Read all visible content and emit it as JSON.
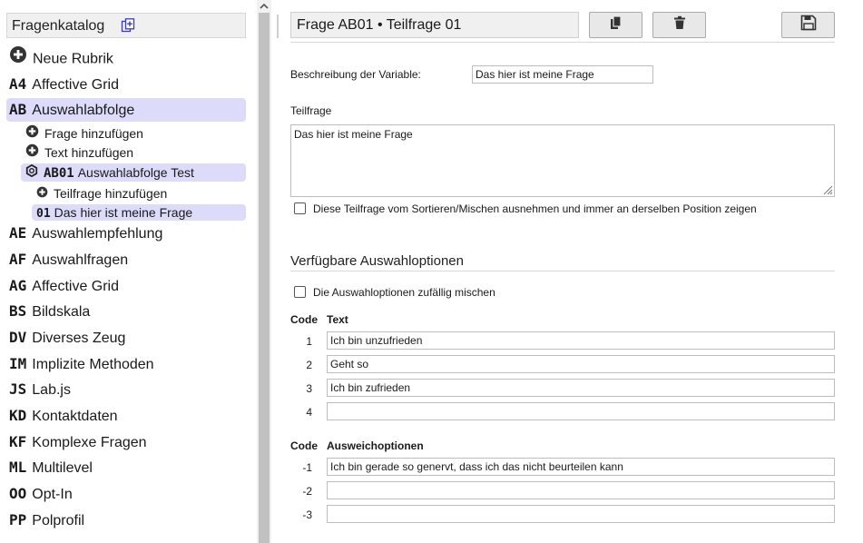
{
  "sidebar": {
    "header": "Fragenkatalog",
    "icons": {
      "header": "copy-add-icon",
      "add": "plus-circle-icon",
      "item": "gear-ring-icon"
    },
    "new_rubric": "Neue Rubrik",
    "rubrics_top": [
      {
        "code": "A4",
        "label": "Affective Grid"
      },
      {
        "code": "AB",
        "label": "Auswahlabfolge"
      }
    ],
    "ab_children": {
      "add_question": "Frage hinzufügen",
      "add_text": "Text hinzufügen",
      "question": {
        "code": "AB01",
        "label": "Auswahlabfolge Test"
      },
      "add_subquestion": "Teilfrage hinzufügen",
      "subquestion": {
        "code": "01",
        "label": "Das hier ist meine Frage"
      }
    },
    "rubrics_rest": [
      {
        "code": "AE",
        "label": "Auswahlempfehlung"
      },
      {
        "code": "AF",
        "label": "Auswahlfragen"
      },
      {
        "code": "AG",
        "label": "Affective Grid"
      },
      {
        "code": "BS",
        "label": "Bildskala"
      },
      {
        "code": "DV",
        "label": "Diverses Zeug"
      },
      {
        "code": "IM",
        "label": "Implizite Methoden"
      },
      {
        "code": "JS",
        "label": "Lab.js"
      },
      {
        "code": "KD",
        "label": "Kontaktdaten"
      },
      {
        "code": "KF",
        "label": "Komplexe Fragen"
      },
      {
        "code": "ML",
        "label": "Multilevel"
      },
      {
        "code": "OO",
        "label": "Opt-In"
      },
      {
        "code": "PP",
        "label": "Polprofil"
      }
    ]
  },
  "main": {
    "title": "Frage AB01  •  Teilfrage 01",
    "toolbar_icons": {
      "copy": "copy-icon",
      "delete": "trash-icon",
      "save": "save-icon"
    },
    "variable_label": "Beschreibung der Variable:",
    "variable_value": "Das hier ist meine Frage",
    "subquestion_label": "Teilfrage",
    "subquestion_text": "Das hier ist meine Frage",
    "fixed_position_label": "Diese Teilfrage vom Sortieren/Mischen ausnehmen und immer an derselben Position zeigen",
    "options_title": "Verfügbare Auswahloptionen",
    "shuffle_label": "Die Auswahloptionen zufällig mischen",
    "col_code": "Code",
    "col_text": "Text",
    "options": [
      {
        "code": "1",
        "text": "Ich bin unzufrieden"
      },
      {
        "code": "2",
        "text": "Geht so"
      },
      {
        "code": "3",
        "text": "Ich bin zufrieden"
      },
      {
        "code": "4",
        "text": ""
      }
    ],
    "col_code2": "Code",
    "col_fallback": "Ausweichoptionen",
    "fallbacks": [
      {
        "code": "-1",
        "text": "Ich bin gerade so genervt, dass ich das nicht beurteilen kann"
      },
      {
        "code": "-2",
        "text": ""
      },
      {
        "code": "-3",
        "text": ""
      }
    ]
  }
}
